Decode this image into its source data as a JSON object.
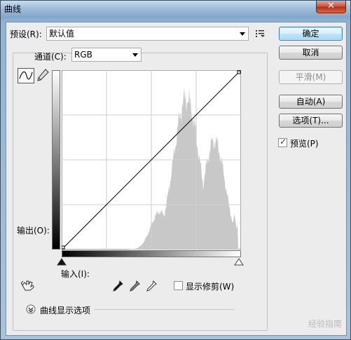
{
  "window": {
    "title": "曲线",
    "close_symbol": "✕"
  },
  "preset": {
    "label": "预设(R):",
    "value": "默认值"
  },
  "channel": {
    "label": "通道(C):",
    "value": "RGB"
  },
  "buttons": {
    "ok": "确定",
    "cancel": "取消",
    "smooth": "平滑(M)",
    "auto": "自动(A)",
    "options": "选项(T)..."
  },
  "preview": {
    "label": "预览(P)",
    "checked": true
  },
  "graph": {
    "output_label": "输出(O):",
    "input_label": "输入(I):",
    "histogram_color": "#c8c8c8",
    "grid_color": "#cfcfcf"
  },
  "clipping": {
    "label": "显示修剪(W)",
    "checked": false
  },
  "curve_display": {
    "label": "曲线显示选项"
  },
  "watermark": "经验指南",
  "colors": {
    "accent": "#3c7fb1",
    "client_bg": "#ececec"
  }
}
